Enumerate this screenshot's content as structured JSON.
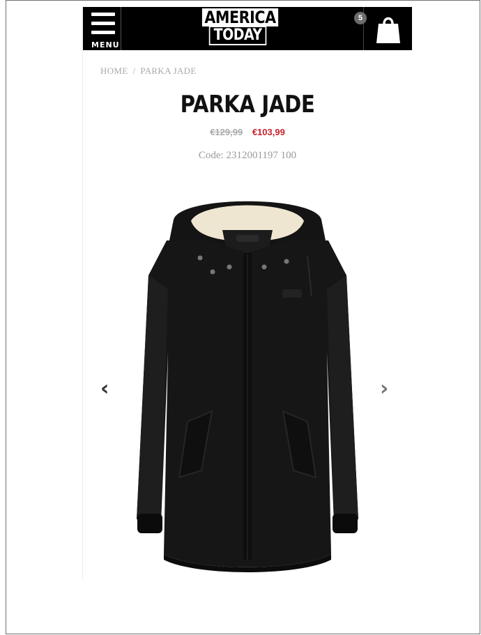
{
  "header": {
    "menu_label": "MENU",
    "logo_line1": "AMERICA",
    "logo_line2": "TODAY",
    "cart_count": "5"
  },
  "breadcrumb": {
    "home": "HOME",
    "separator": "/",
    "current": "PARKA JADE"
  },
  "product": {
    "title": "PARKA JADE",
    "old_price": "€129,99",
    "new_price": "€103,99",
    "code": "Code: 2312001197 100",
    "image_icon": "black-hooded-parka-photo"
  },
  "gallery": {
    "prev_arrow": "‹",
    "next_arrow": "›"
  },
  "colors": {
    "header_bg": "#000000",
    "sale_price": "#c8222d",
    "muted_text": "#a9a9a9"
  }
}
